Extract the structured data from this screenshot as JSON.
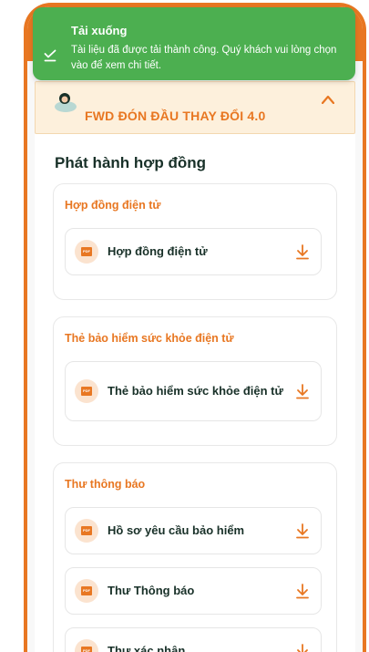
{
  "toast": {
    "title": "Tải xuống",
    "message": "Tài liệu đã được tải thành công. Quý khách vui lòng chọn vào để xem chi tiết.",
    "color": "#4caf50"
  },
  "banner": {
    "title": "FWD ĐÓN ĐẦU THAY ĐỔI 4.0"
  },
  "section_title": "Phát hành hợp đồng",
  "cards": [
    {
      "title": "Hợp đồng điện tử",
      "documents": [
        {
          "label": "Hợp đồng điện tử"
        }
      ]
    },
    {
      "title": "Thẻ bảo hiểm sức khỏe điện tử",
      "documents": [
        {
          "label": "Thẻ bảo hiểm sức khỏe điện tử"
        }
      ]
    },
    {
      "title": "Thư thông báo",
      "documents": [
        {
          "label": "Hồ sơ yêu cầu bảo hiểm"
        },
        {
          "label": "Thư Thông báo"
        },
        {
          "label": "Thư xác nhận"
        }
      ]
    }
  ],
  "icons": {
    "document": "pdf-file-icon",
    "download": "download-icon",
    "toast": "check-icon",
    "collapse": "chevron-up-icon"
  },
  "colors": {
    "brand_orange": "#e87722",
    "banner_bg": "#fdf0dc",
    "text_dark": "#183028"
  }
}
